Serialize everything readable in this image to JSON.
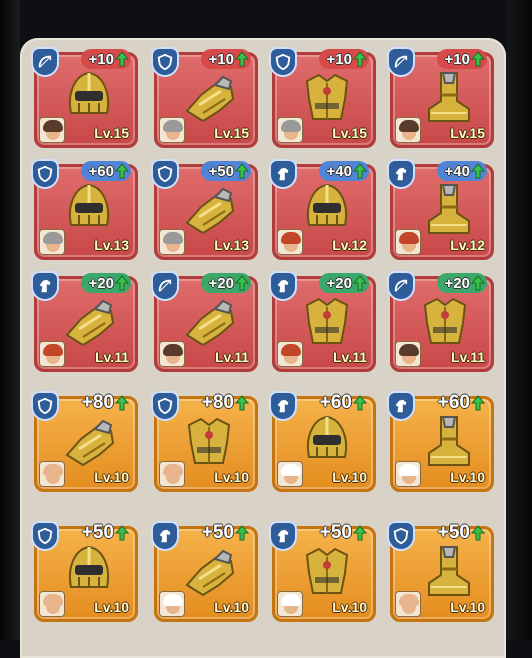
{
  "colors": {
    "red_card": "#cf5252",
    "gold_card": "#eb9b2e",
    "class_badge": "#2e5d9a",
    "upgrade_arrow": "#38c24a"
  },
  "equipment": [
    {
      "class_icon": "bow-icon",
      "item": "helmet",
      "rarity": "red",
      "bonus": "+10",
      "pill": "pill-red",
      "level": "Lv.15",
      "hero": "warrior-portrait"
    },
    {
      "class_icon": "shield-icon",
      "item": "gauntlet",
      "rarity": "red",
      "bonus": "+10",
      "pill": "pill-red",
      "level": "Lv.15",
      "hero": "knight-portrait"
    },
    {
      "class_icon": "shield-icon",
      "item": "chestplate",
      "rarity": "red",
      "bonus": "+10",
      "pill": "pill-red",
      "level": "Lv.15",
      "hero": "knight-portrait"
    },
    {
      "class_icon": "bow-icon",
      "item": "boot",
      "rarity": "red",
      "bonus": "+10",
      "pill": "pill-red",
      "level": "Lv.15",
      "hero": "warrior-portrait"
    },
    {
      "class_icon": "shield-icon",
      "item": "helmet",
      "rarity": "red",
      "bonus": "+60",
      "pill": "pill-blue",
      "level": "Lv.13",
      "hero": "knight-portrait"
    },
    {
      "class_icon": "shield-icon",
      "item": "gauntlet",
      "rarity": "red",
      "bonus": "+50",
      "pill": "pill-blue",
      "level": "Lv.13",
      "hero": "knight-portrait"
    },
    {
      "class_icon": "horse-icon",
      "item": "helmet",
      "rarity": "red",
      "bonus": "+40",
      "pill": "pill-blue",
      "level": "Lv.12",
      "hero": "rider-portrait"
    },
    {
      "class_icon": "horse-icon",
      "item": "boot",
      "rarity": "red",
      "bonus": "+40",
      "pill": "pill-blue",
      "level": "Lv.12",
      "hero": "rider-portrait"
    },
    {
      "class_icon": "horse-icon",
      "item": "gauntlet",
      "rarity": "red",
      "bonus": "+20",
      "pill": "pill-green",
      "level": "Lv.11",
      "hero": "rider-portrait"
    },
    {
      "class_icon": "bow-icon",
      "item": "gauntlet",
      "rarity": "red",
      "bonus": "+20",
      "pill": "pill-green",
      "level": "Lv.11",
      "hero": "warrior-portrait"
    },
    {
      "class_icon": "horse-icon",
      "item": "chestplate",
      "rarity": "red",
      "bonus": "+20",
      "pill": "pill-green",
      "level": "Lv.11",
      "hero": "rider-portrait"
    },
    {
      "class_icon": "bow-icon",
      "item": "chestplate",
      "rarity": "red",
      "bonus": "+20",
      "pill": "pill-green",
      "level": "Lv.11",
      "hero": "warrior-portrait"
    },
    {
      "class_icon": "shield-icon",
      "item": "gauntlet",
      "rarity": "gold",
      "bonus": "+80",
      "pill": "plain",
      "level": "Lv.10",
      "hero": "bald-portrait"
    },
    {
      "class_icon": "shield-icon",
      "item": "chestplate",
      "rarity": "gold",
      "bonus": "+80",
      "pill": "plain",
      "level": "Lv.10",
      "hero": "bald-portrait"
    },
    {
      "class_icon": "horse-icon",
      "item": "helmet",
      "rarity": "gold",
      "bonus": "+60",
      "pill": "plain",
      "level": "Lv.10",
      "hero": "nun-portrait"
    },
    {
      "class_icon": "horse-icon",
      "item": "boot",
      "rarity": "gold",
      "bonus": "+60",
      "pill": "plain",
      "level": "Lv.10",
      "hero": "nun-portrait"
    },
    {
      "class_icon": "shield-icon",
      "item": "helmet",
      "rarity": "gold",
      "bonus": "+50",
      "pill": "plain",
      "level": "Lv.10",
      "hero": "bald-portrait"
    },
    {
      "class_icon": "horse-icon",
      "item": "gauntlet",
      "rarity": "gold",
      "bonus": "+50",
      "pill": "plain",
      "level": "Lv.10",
      "hero": "nun-portrait"
    },
    {
      "class_icon": "horse-icon",
      "item": "chestplate",
      "rarity": "gold",
      "bonus": "+50",
      "pill": "plain",
      "level": "Lv.10",
      "hero": "nun-portrait"
    },
    {
      "class_icon": "shield-icon",
      "item": "boot",
      "rarity": "gold",
      "bonus": "+50",
      "pill": "plain",
      "level": "Lv.10",
      "hero": "bald-portrait"
    }
  ]
}
